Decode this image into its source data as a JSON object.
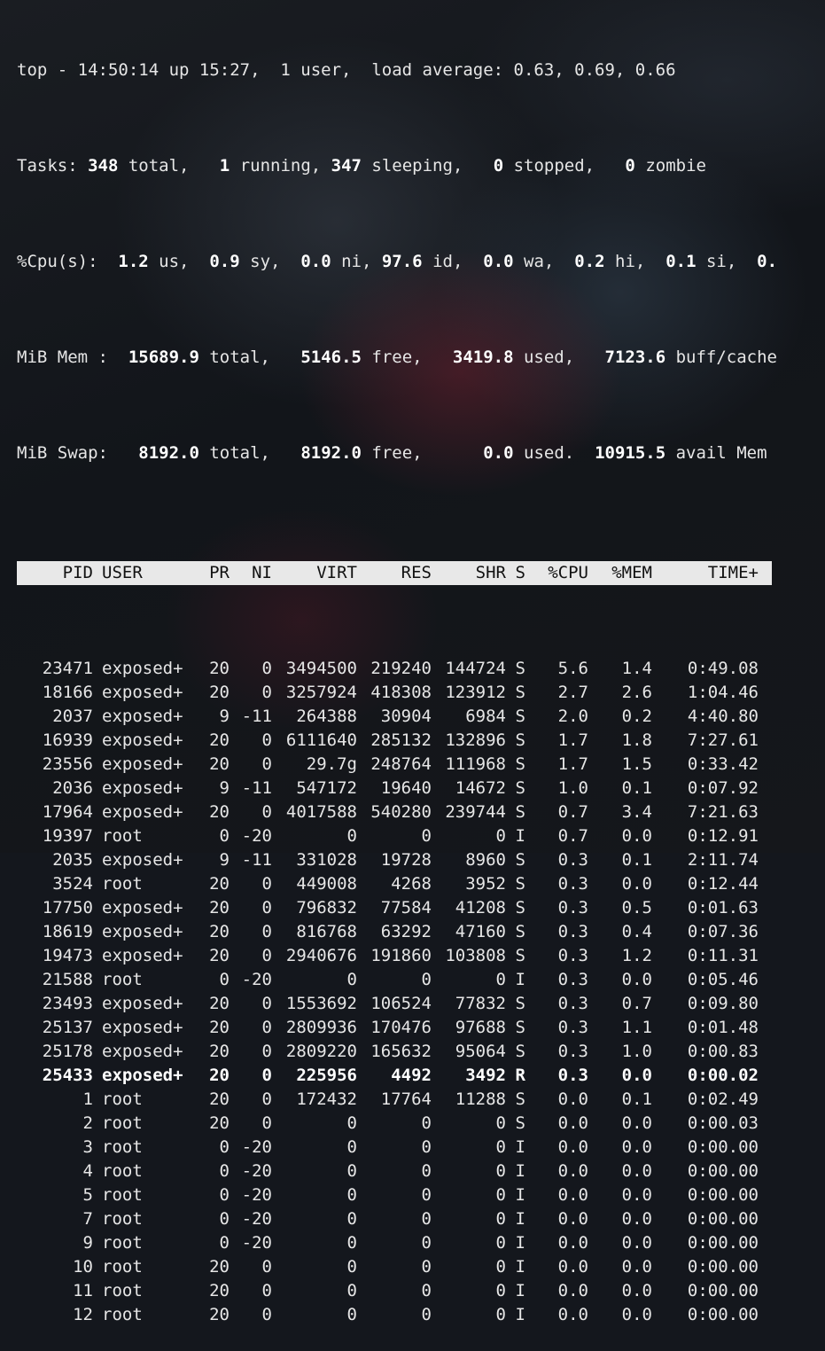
{
  "summary": {
    "l1": {
      "a": "top - 14:50:14 up 15:27,  1 user,  load average: 0.63, 0.69, 0.66"
    },
    "l2": {
      "p0": "Tasks: ",
      "v1": "348",
      "p1": " total,   ",
      "v2": "1",
      "p2": " running, ",
      "v3": "347",
      "p3": " sleeping,   ",
      "v4": "0",
      "p4": " stopped,   ",
      "v5": "0",
      "p5": " zombie"
    },
    "l3": {
      "p0": "%Cpu(s):  ",
      "v1": "1.2",
      "p1": " us,  ",
      "v2": "0.9",
      "p2": " sy,  ",
      "v3": "0.0",
      "p3": " ni, ",
      "v4": "97.6",
      "p4": " id,  ",
      "v5": "0.0",
      "p5": " wa,  ",
      "v6": "0.2",
      "p6": " hi,  ",
      "v7": "0.1",
      "p7": " si,  ",
      "v8": "0."
    },
    "l4": {
      "p0": "MiB Mem :  ",
      "v1": "15689.9",
      "p1": " total,   ",
      "v2": "5146.5",
      "p2": " free,   ",
      "v3": "3419.8",
      "p3": " used,   ",
      "v4": "7123.6",
      "p4": " buff/cache"
    },
    "l5": {
      "p0": "MiB Swap:   ",
      "v1": "8192.0",
      "p1": " total,   ",
      "v2": "8192.0",
      "p2": " free,      ",
      "v3": "0.0",
      "p3": " used.  ",
      "v4": "10915.5",
      "p4": " avail Mem"
    }
  },
  "columns": [
    "PID",
    "USER",
    "PR",
    "NI",
    "VIRT",
    "RES",
    "SHR",
    "S",
    "%CPU",
    "%MEM",
    "TIME+"
  ],
  "processes": [
    [
      "23471",
      "exposed+",
      "20",
      "0",
      "3494500",
      "219240",
      "144724",
      "S",
      "5.6",
      "1.4",
      "0:49.08"
    ],
    [
      "18166",
      "exposed+",
      "20",
      "0",
      "3257924",
      "418308",
      "123912",
      "S",
      "2.7",
      "2.6",
      "1:04.46"
    ],
    [
      "2037",
      "exposed+",
      "9",
      "-11",
      "264388",
      "30904",
      "6984",
      "S",
      "2.0",
      "0.2",
      "4:40.80"
    ],
    [
      "16939",
      "exposed+",
      "20",
      "0",
      "6111640",
      "285132",
      "132896",
      "S",
      "1.7",
      "1.8",
      "7:27.61"
    ],
    [
      "23556",
      "exposed+",
      "20",
      "0",
      "29.7g",
      "248764",
      "111968",
      "S",
      "1.7",
      "1.5",
      "0:33.42"
    ],
    [
      "2036",
      "exposed+",
      "9",
      "-11",
      "547172",
      "19640",
      "14672",
      "S",
      "1.0",
      "0.1",
      "0:07.92"
    ],
    [
      "17964",
      "exposed+",
      "20",
      "0",
      "4017588",
      "540280",
      "239744",
      "S",
      "0.7",
      "3.4",
      "7:21.63"
    ],
    [
      "19397",
      "root",
      "0",
      "-20",
      "0",
      "0",
      "0",
      "I",
      "0.7",
      "0.0",
      "0:12.91"
    ],
    [
      "2035",
      "exposed+",
      "9",
      "-11",
      "331028",
      "19728",
      "8960",
      "S",
      "0.3",
      "0.1",
      "2:11.74"
    ],
    [
      "3524",
      "root",
      "20",
      "0",
      "449008",
      "4268",
      "3952",
      "S",
      "0.3",
      "0.0",
      "0:12.44"
    ],
    [
      "17750",
      "exposed+",
      "20",
      "0",
      "796832",
      "77584",
      "41208",
      "S",
      "0.3",
      "0.5",
      "0:01.63"
    ],
    [
      "18619",
      "exposed+",
      "20",
      "0",
      "816768",
      "63292",
      "47160",
      "S",
      "0.3",
      "0.4",
      "0:07.36"
    ],
    [
      "19473",
      "exposed+",
      "20",
      "0",
      "2940676",
      "191860",
      "103808",
      "S",
      "0.3",
      "1.2",
      "0:11.31"
    ],
    [
      "21588",
      "root",
      "0",
      "-20",
      "0",
      "0",
      "0",
      "I",
      "0.3",
      "0.0",
      "0:05.46"
    ],
    [
      "23493",
      "exposed+",
      "20",
      "0",
      "1553692",
      "106524",
      "77832",
      "S",
      "0.3",
      "0.7",
      "0:09.80"
    ],
    [
      "25137",
      "exposed+",
      "20",
      "0",
      "2809936",
      "170476",
      "97688",
      "S",
      "0.3",
      "1.1",
      "0:01.48"
    ],
    [
      "25178",
      "exposed+",
      "20",
      "0",
      "2809220",
      "165632",
      "95064",
      "S",
      "0.3",
      "1.0",
      "0:00.83"
    ],
    [
      "25433",
      "exposed+",
      "20",
      "0",
      "225956",
      "4492",
      "3492",
      "R",
      "0.3",
      "0.0",
      "0:00.02"
    ],
    [
      "1",
      "root",
      "20",
      "0",
      "172432",
      "17764",
      "11288",
      "S",
      "0.0",
      "0.1",
      "0:02.49"
    ],
    [
      "2",
      "root",
      "20",
      "0",
      "0",
      "0",
      "0",
      "S",
      "0.0",
      "0.0",
      "0:00.03"
    ],
    [
      "3",
      "root",
      "0",
      "-20",
      "0",
      "0",
      "0",
      "I",
      "0.0",
      "0.0",
      "0:00.00"
    ],
    [
      "4",
      "root",
      "0",
      "-20",
      "0",
      "0",
      "0",
      "I",
      "0.0",
      "0.0",
      "0:00.00"
    ],
    [
      "5",
      "root",
      "0",
      "-20",
      "0",
      "0",
      "0",
      "I",
      "0.0",
      "0.0",
      "0:00.00"
    ],
    [
      "7",
      "root",
      "0",
      "-20",
      "0",
      "0",
      "0",
      "I",
      "0.0",
      "0.0",
      "0:00.00"
    ],
    [
      "9",
      "root",
      "0",
      "-20",
      "0",
      "0",
      "0",
      "I",
      "0.0",
      "0.0",
      "0:00.00"
    ],
    [
      "10",
      "root",
      "20",
      "0",
      "0",
      "0",
      "0",
      "I",
      "0.0",
      "0.0",
      "0:00.00"
    ],
    [
      "11",
      "root",
      "20",
      "0",
      "0",
      "0",
      "0",
      "I",
      "0.0",
      "0.0",
      "0:00.00"
    ],
    [
      "12",
      "root",
      "20",
      "0",
      "0",
      "0",
      "0",
      "I",
      "0.0",
      "0.0",
      "0:00.00"
    ]
  ],
  "highlight_pid": "25433",
  "colors": {
    "header_bg": "#e8e8e8",
    "text": "#e6e6e6",
    "bold": "#ffffff"
  }
}
